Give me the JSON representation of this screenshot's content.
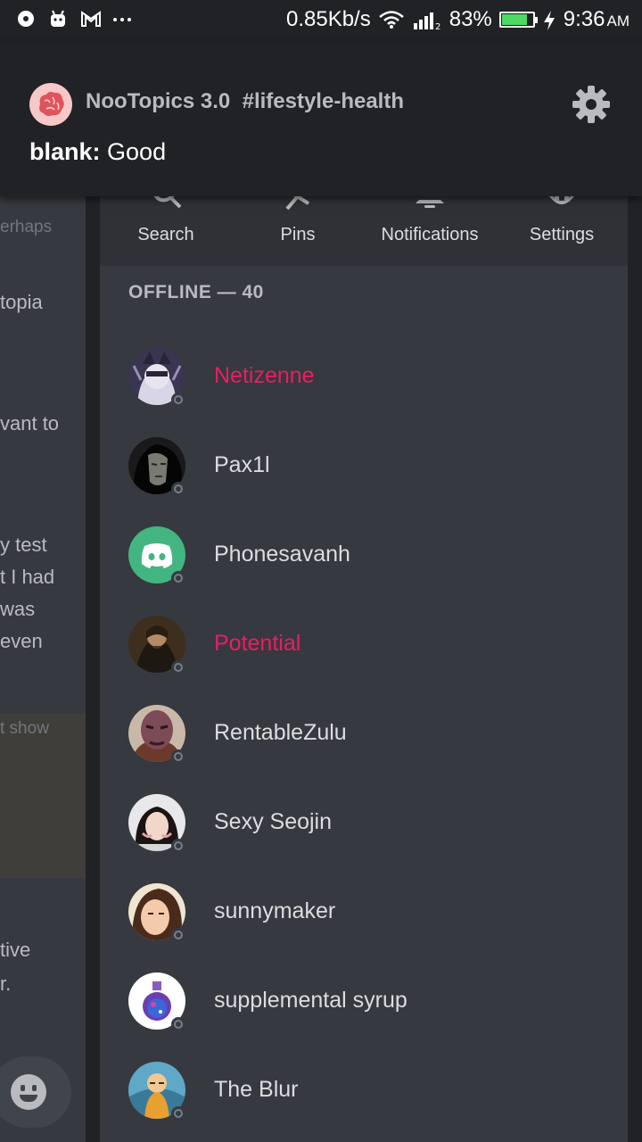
{
  "status_bar": {
    "network_speed": "0.85Kb/s",
    "battery": "83%",
    "battery_level": 0.83,
    "time": "9:36",
    "ampm": "AM",
    "icons": [
      "notification-dot-icon",
      "android-icon",
      "gmail-icon",
      "more-icon",
      "wifi-icon",
      "signal-icon",
      "battery-icon",
      "charging-icon"
    ]
  },
  "notification": {
    "server_name": "NooTopics 3.0",
    "channel": "#lifestyle-health",
    "author": "blank:",
    "message": "Good"
  },
  "chat_fragments": [
    "erhaps",
    "topia",
    "vant to",
    "y test",
    "t I had",
    "was",
    "even",
    "t show",
    "tive",
    "r."
  ],
  "toolbar": {
    "search": "Search",
    "pins": "Pins",
    "notifications": "Notifications",
    "settings": "Settings"
  },
  "members_section": {
    "label": "OFFLINE — 40"
  },
  "members": [
    {
      "name": "Netizenne",
      "role_color": "#e91e63"
    },
    {
      "name": "Pax1l"
    },
    {
      "name": "Phonesavanh"
    },
    {
      "name": "Potential",
      "role_color": "#e91e63"
    },
    {
      "name": "RentableZulu"
    },
    {
      "name": "Sexy Seojin"
    },
    {
      "name": "sunnymaker"
    },
    {
      "name": "supplemental syrup"
    },
    {
      "name": "The Blur"
    }
  ]
}
